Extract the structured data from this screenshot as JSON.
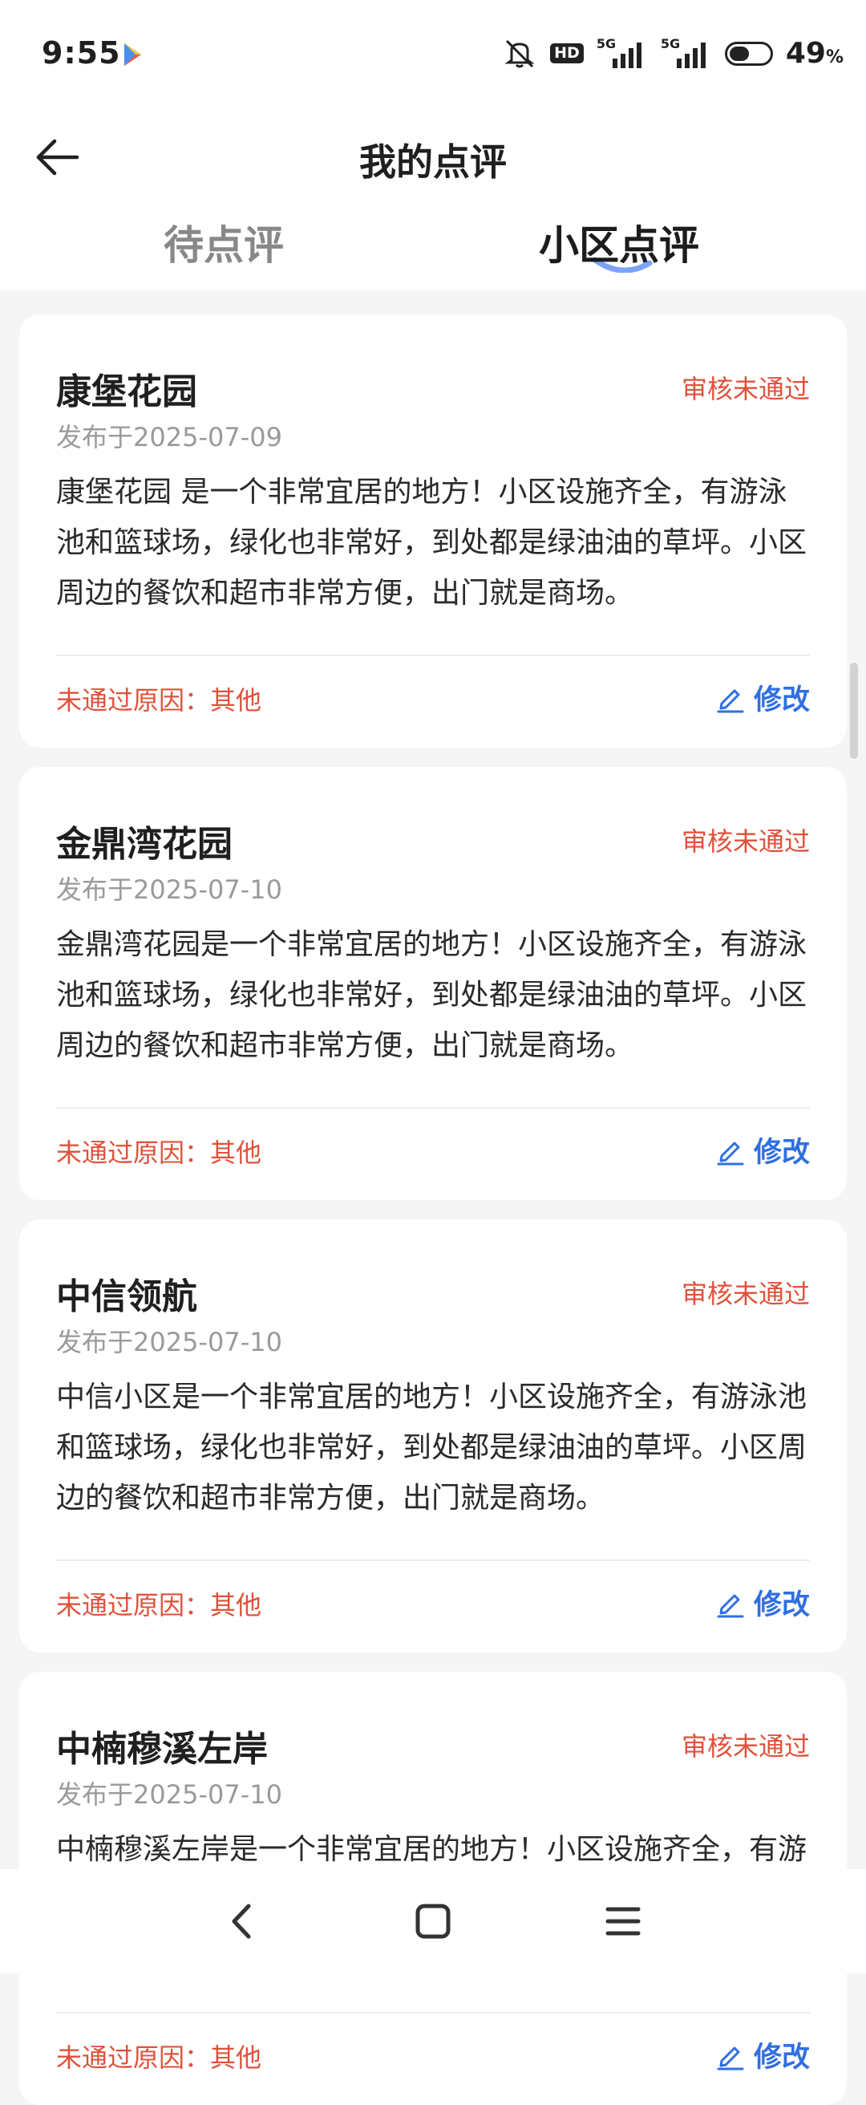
{
  "status_bar": {
    "time": "9:55",
    "hd_label": "HD",
    "network_1": "5G",
    "network_2": "5G",
    "battery_percent": "49",
    "battery_unit": "%",
    "battery_level": 0.49
  },
  "header": {
    "title": "我的点评"
  },
  "tabs": [
    {
      "label": "待点评",
      "active": false
    },
    {
      "label": "小区点评",
      "active": true
    }
  ],
  "colors": {
    "status_red": "#e0513b",
    "link_blue": "#2f6fe2",
    "background": "#f5f5f6"
  },
  "reviews": [
    {
      "name": "康堡花园",
      "status": "审核未通过",
      "date": "发布于2025-07-09",
      "content": "康堡花园 是一个非常宜居的地方！小区设施齐全，有游泳池和篮球场，绿化也非常好，到处都是绿油油的草坪。小区周边的餐饮和超市非常方便，出门就是商场。",
      "reason": "未通过原因：其他",
      "edit_label": "修改"
    },
    {
      "name": "金鼎湾花园",
      "status": "审核未通过",
      "date": "发布于2025-07-10",
      "content": "金鼎湾花园是一个非常宜居的地方！小区设施齐全，有游泳池和篮球场，绿化也非常好，到处都是绿油油的草坪。小区周边的餐饮和超市非常方便，出门就是商场。",
      "reason": "未通过原因：其他",
      "edit_label": "修改"
    },
    {
      "name": "中信领航",
      "status": "审核未通过",
      "date": "发布于2025-07-10",
      "content": "中信小区是一个非常宜居的地方！小区设施齐全，有游泳池和篮球场，绿化也非常好，到处都是绿油油的草坪。小区周边的餐饮和超市非常方便，出门就是商场。",
      "reason": "未通过原因：其他",
      "edit_label": "修改"
    },
    {
      "name": "中楠穆溪左岸",
      "status": "审核未通过",
      "date": "发布于2025-07-10",
      "content": "中楠穆溪左岸是一个非常宜居的地方！小区设施齐全，有游泳池和篮球场，绿化也非常好，到处都是绿油油的草坪。",
      "reason": "未通过原因：其他",
      "edit_label": "修改"
    }
  ],
  "icons": {
    "back": "arrow-left-icon",
    "edit": "pencil-edit-icon",
    "nav_back": "chevron-left-icon",
    "nav_home": "square-home-icon",
    "nav_menu": "menu-lines-icon"
  }
}
